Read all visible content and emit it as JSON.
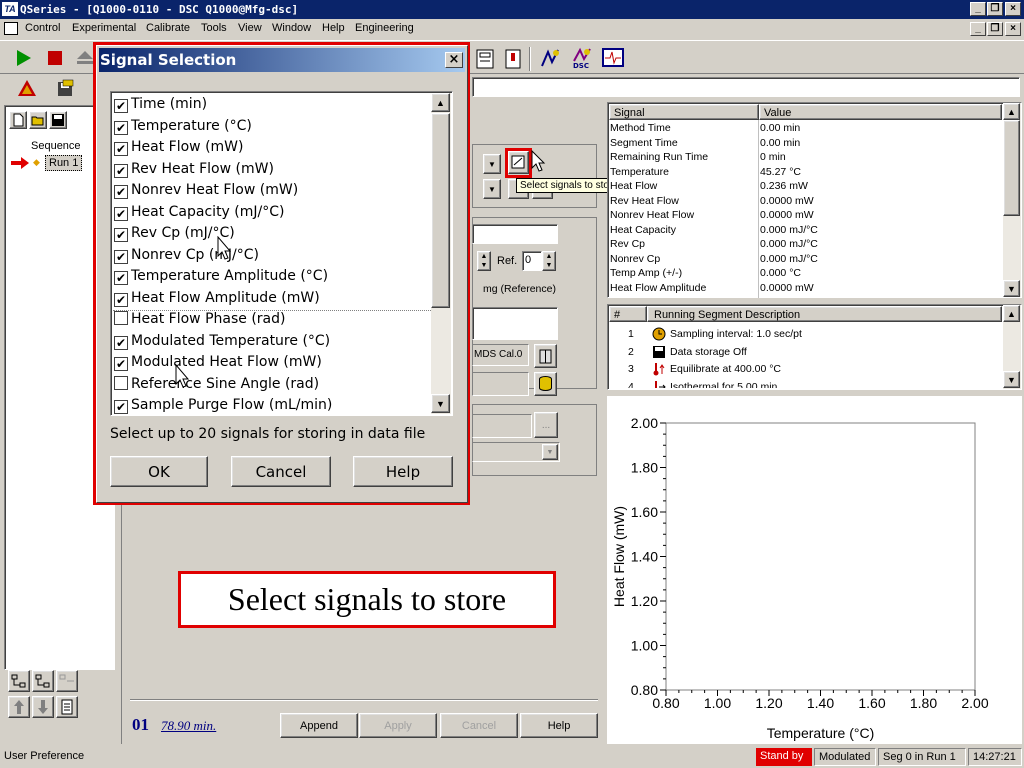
{
  "window": {
    "title": "QSeries - [Q1000-0110 - DSC Q1000@Mfg-dsc]",
    "app_icon": "TA"
  },
  "menu": [
    "Control",
    "Experimental",
    "Calibrate",
    "Tools",
    "View",
    "Window",
    "Help",
    "Engineering"
  ],
  "sequence": {
    "header": "Sequence",
    "run": "Run 1"
  },
  "main": {
    "sample_pan_value": "0",
    "ref_label": "Ref.",
    "ref_value": "0",
    "mg_reference": "mg (Reference)",
    "cal_value": "MDS Cal.0",
    "run_number": "01",
    "run_time": "78.90 min.",
    "append": "Append",
    "apply": "Apply",
    "cancel": "Cancel",
    "help": "Help",
    "ellipsis": "...",
    "tooltip": "Select signals to store"
  },
  "dialog": {
    "title": "Signal Selection",
    "signals": [
      {
        "label": "Time (min)",
        "checked": true
      },
      {
        "label": "Temperature (°C)",
        "checked": true
      },
      {
        "label": "Heat Flow (mW)",
        "checked": true
      },
      {
        "label": "Rev Heat Flow (mW)",
        "checked": true
      },
      {
        "label": "Nonrev Heat Flow (mW)",
        "checked": true
      },
      {
        "label": "Heat Capacity (mJ/°C)",
        "checked": true
      },
      {
        "label": "Rev Cp (mJ/°C)",
        "checked": true
      },
      {
        "label": "Nonrev Cp (mJ/°C)",
        "checked": true
      },
      {
        "label": "Temperature Amplitude (°C)",
        "checked": true
      },
      {
        "label": "Heat Flow Amplitude (mW)",
        "checked": true
      },
      {
        "label": "Heat Flow Phase (rad)",
        "checked": false
      },
      {
        "label": "Modulated Temperature (°C)",
        "checked": true
      },
      {
        "label": "Modulated Heat Flow (mW)",
        "checked": true
      },
      {
        "label": "Reference Sine Angle (rad)",
        "checked": false
      },
      {
        "label": "Sample Purge Flow (mL/min)",
        "checked": true
      }
    ],
    "hint": "Select up to 20 signals for storing in data file",
    "ok": "OK",
    "cancel": "Cancel",
    "help": "Help"
  },
  "signal_table": {
    "headers": [
      "Signal",
      "Value"
    ],
    "rows": [
      [
        "Method Time",
        "0.00 min"
      ],
      [
        "Segment Time",
        "0.00 min"
      ],
      [
        "Remaining Run Time",
        "0 min"
      ],
      [
        "Temperature",
        "45.27 °C"
      ],
      [
        "Heat Flow",
        "0.236 mW"
      ],
      [
        "Rev Heat Flow",
        "0.0000 mW"
      ],
      [
        "Nonrev Heat Flow",
        "0.0000 mW"
      ],
      [
        "Heat Capacity",
        "0.000 mJ/°C"
      ],
      [
        "Rev Cp",
        "0.000 mJ/°C"
      ],
      [
        "Nonrev Cp",
        "0.000 mJ/°C"
      ],
      [
        "Temp Amp (+/-)",
        "0.000 °C"
      ],
      [
        "Heat Flow Amplitude",
        "0.0000 mW"
      ]
    ]
  },
  "segments": {
    "headers": [
      "#",
      "Running Segment Description"
    ],
    "rows": [
      {
        "n": "1",
        "text": "Sampling interval: 1.0 sec/pt",
        "icon": "clock-icon"
      },
      {
        "n": "2",
        "text": "Data storage Off",
        "icon": "floppy-icon"
      },
      {
        "n": "3",
        "text": "Equilibrate at 400.00 °C",
        "icon": "thermometer-up-icon"
      },
      {
        "n": "4",
        "text": "Isothermal for 5.00 min",
        "icon": "thermometer-hold-icon"
      }
    ]
  },
  "chart_data": {
    "type": "line",
    "xlabel": "Temperature (°C)",
    "ylabel": "Heat Flow (mW)",
    "xlim": [
      0.8,
      2.0
    ],
    "ylim": [
      0.8,
      2.0
    ],
    "x_ticks": [
      "0.80",
      "1.00",
      "1.20",
      "1.40",
      "1.60",
      "1.80",
      "2.00"
    ],
    "y_ticks": [
      "0.80",
      "1.00",
      "1.20",
      "1.40",
      "1.60",
      "1.80",
      "2.00"
    ],
    "series": []
  },
  "status": {
    "left": "User Preference",
    "state": "Stand by",
    "mode": "Modulated",
    "seg": "Seg  0 in Run  1",
    "time": "14:27:21"
  },
  "callout": "Select signals to store",
  "colors": {
    "accent": "#0a246a",
    "highlight": "#e00000",
    "standby": "#e00000"
  }
}
